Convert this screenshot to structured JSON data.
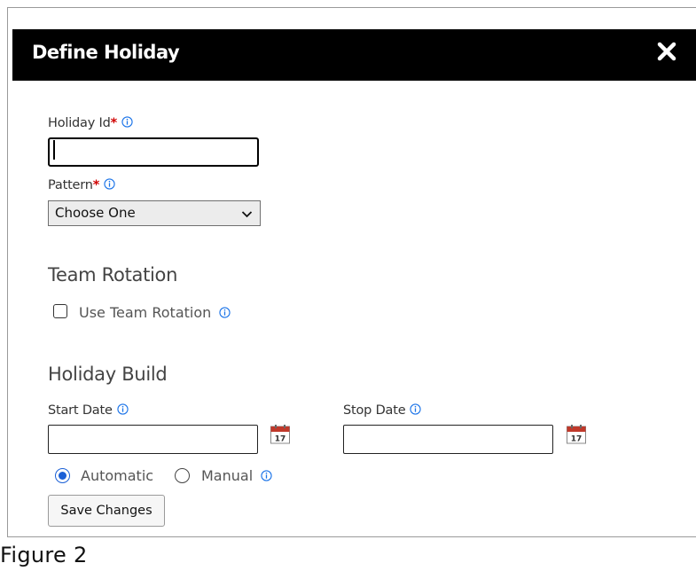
{
  "dialog": {
    "title": "Define Holiday"
  },
  "form": {
    "holiday_id": {
      "label": "Holiday Id",
      "required_marker": "*",
      "value": ""
    },
    "pattern": {
      "label": "Pattern",
      "required_marker": "*",
      "selected": "Choose One"
    }
  },
  "team_rotation": {
    "heading": "Team Rotation",
    "checkbox_label": "Use Team Rotation",
    "checked": false
  },
  "holiday_build": {
    "heading": "Holiday Build",
    "start_date": {
      "label": "Start Date",
      "value": ""
    },
    "stop_date": {
      "label": "Stop Date",
      "value": ""
    },
    "calendar_icon_day": "17",
    "mode_options": [
      {
        "label": "Automatic",
        "selected": true
      },
      {
        "label": "Manual",
        "selected": false
      }
    ]
  },
  "actions": {
    "save_label": "Save Changes"
  },
  "caption": "Figure 2",
  "colors": {
    "titlebar": "#000000",
    "required": "#d00000",
    "info_icon": "#1a73e8",
    "radio_selected": "#1a5fd6",
    "calendar_red": "#c0392b"
  }
}
